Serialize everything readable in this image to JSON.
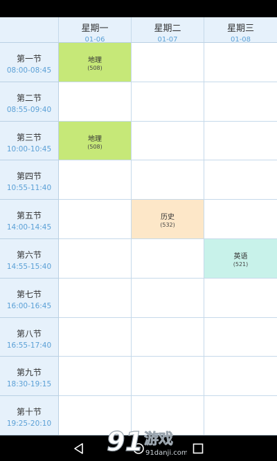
{
  "header": {
    "columns": [
      {
        "day": "星期一",
        "date": "01-06"
      },
      {
        "day": "星期二",
        "date": "01-07"
      },
      {
        "day": "星期三",
        "date": "01-08"
      }
    ]
  },
  "periods": [
    {
      "name": "第一节",
      "time": "08:00-08:45"
    },
    {
      "name": "第二节",
      "time": "08:55-09:40"
    },
    {
      "name": "第三节",
      "time": "10:00-10:45"
    },
    {
      "name": "第四节",
      "time": "10:55-11:40"
    },
    {
      "name": "第五节",
      "time": "14:00-14:45"
    },
    {
      "name": "第六节",
      "time": "14:55-15:40"
    },
    {
      "name": "第七节",
      "time": "16:00-16:45"
    },
    {
      "name": "第八节",
      "time": "16:55-17:40"
    },
    {
      "name": "第九节",
      "time": "18:30-19:15"
    },
    {
      "name": "第十节",
      "time": "19:25-20:10"
    }
  ],
  "courses": [
    {
      "period": 0,
      "day": 0,
      "name": "地理",
      "room": "(508)",
      "color": "#c6e878"
    },
    {
      "period": 2,
      "day": 0,
      "name": "地理",
      "room": "(508)",
      "color": "#c6e878"
    },
    {
      "period": 4,
      "day": 1,
      "name": "历史",
      "room": "(532)",
      "color": "#fde7c8"
    },
    {
      "period": 5,
      "day": 2,
      "name": "英语",
      "room": "(521)",
      "color": "#c8f2ea"
    }
  ],
  "colors": {
    "header_bg": "#e6f1fb",
    "time_text": "#5ba0d6",
    "grid_line": "#c5d9ea"
  },
  "navigation": {
    "icons": [
      "back-icon",
      "home-icon",
      "recents-icon"
    ]
  },
  "watermark": {
    "logo_text": "游戏",
    "site_text": "91danji.com"
  }
}
